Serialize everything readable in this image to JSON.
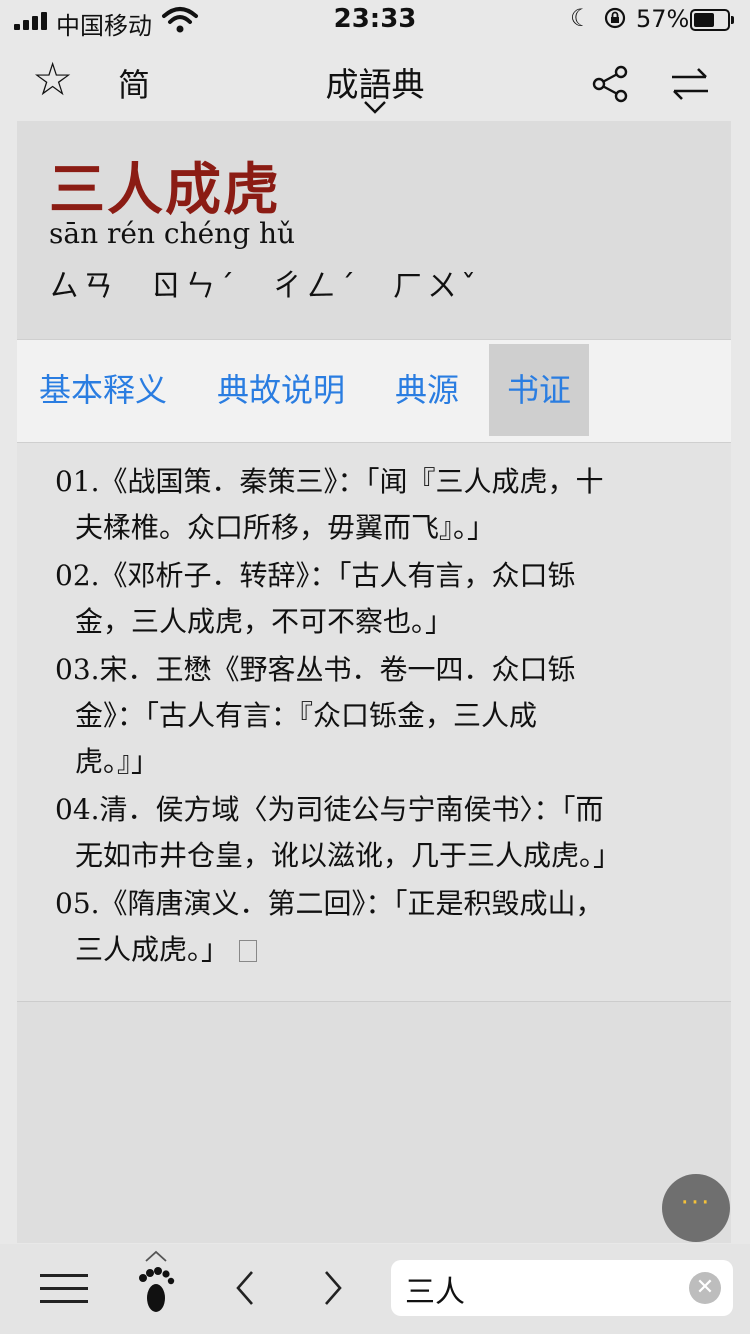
{
  "status_bar": {
    "carrier": "中国移动",
    "time": "23:33",
    "battery_pct": "57%",
    "battery_level": 0.57,
    "icons": [
      "signal-icon",
      "wifi-icon",
      "moon-icon",
      "orientation-lock-icon",
      "battery-icon"
    ]
  },
  "nav": {
    "favorite_icon": "☆",
    "script_toggle": "简",
    "title": "成語典",
    "icons": [
      "star-icon",
      "chevron-down-icon",
      "share-icon",
      "swap-icon"
    ]
  },
  "entry": {
    "idiom": "三人成虎",
    "pinyin": "sān rén chéng hǔ",
    "zhuyin": "ㄙㄢ　ㄖㄣˊ　ㄔㄥˊ　ㄏㄨˇ",
    "accent_color": "#8b1c14"
  },
  "tabs": [
    {
      "label": "基本释义",
      "active": false
    },
    {
      "label": "典故说明",
      "active": false
    },
    {
      "label": "典源",
      "active": false
    },
    {
      "label": "书证",
      "active": true
    }
  ],
  "citations": [
    {
      "num": "01.",
      "first": "《战国策．秦策三》：「闻『三人成虎，十",
      "rest": [
        "夫楺椎。众口所移，毋翼而飞』。」"
      ]
    },
    {
      "num": "02.",
      "first": "《邓析子．转辞》：「古人有言，众口铄",
      "rest": [
        "金，三人成虎，不可不察也。」"
      ]
    },
    {
      "num": "03.",
      "first": "宋．王懋《野客丛书．卷一四．众口铄",
      "rest": [
        "金》：「古人有言：『众口铄金，三人成",
        "虎。』」"
      ]
    },
    {
      "num": "04.",
      "first": "清．侯方域〈为司徒公与宁南侯书〉：「而",
      "rest": [
        "无如市井仓皇，讹以滋讹，几于三人成虎。」"
      ]
    },
    {
      "num": "05.",
      "first": "《隋唐演义．第二回》：「正是积毁成山，",
      "rest": [
        "三人成虎。」"
      ]
    }
  ],
  "fab": {
    "label": "···",
    "dot_color": "#f3c13a"
  },
  "bottom": {
    "search_value": "三人",
    "clear_label": "✕",
    "icons": [
      "menu-icon",
      "footprint-icon",
      "back-icon",
      "forward-icon",
      "clear-icon"
    ]
  }
}
